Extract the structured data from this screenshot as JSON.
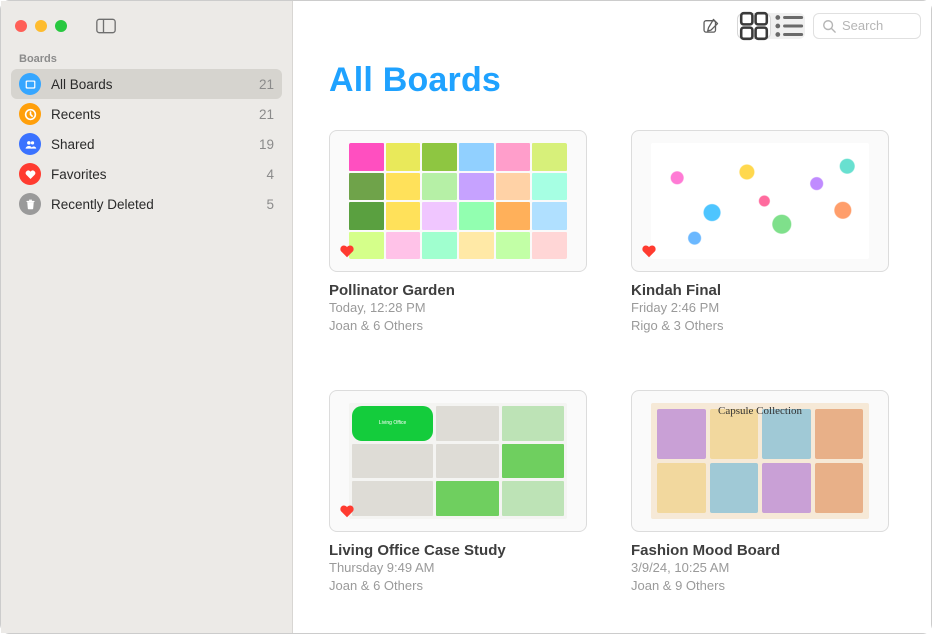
{
  "sidebar": {
    "header": "Boards",
    "items": [
      {
        "icon": "folder",
        "color": "ic-blue",
        "label": "All Boards",
        "count": 21,
        "selected": true
      },
      {
        "icon": "clock",
        "color": "ic-orange",
        "label": "Recents",
        "count": 21,
        "selected": false
      },
      {
        "icon": "people",
        "color": "ic-dblue",
        "label": "Shared",
        "count": 19,
        "selected": false
      },
      {
        "icon": "heart",
        "color": "ic-red",
        "label": "Favorites",
        "count": 4,
        "selected": false
      },
      {
        "icon": "trash",
        "color": "ic-gray",
        "label": "Recently Deleted",
        "count": 5,
        "selected": false
      }
    ]
  },
  "toolbar": {
    "compose_icon": "compose",
    "grid_icon": "grid",
    "list_icon": "list",
    "search_placeholder": "Search",
    "active_view": "grid"
  },
  "page": {
    "title": "All Boards"
  },
  "boards": [
    {
      "title": "Pollinator Garden",
      "time": "Today, 12:28 PM",
      "people": "Joan & 6 Others",
      "favorite": true,
      "art": "garden"
    },
    {
      "title": "Kindah Final",
      "time": "Friday 2:46 PM",
      "people": "Rigo & 3 Others",
      "favorite": true,
      "art": "doodle"
    },
    {
      "title": "Living Office Case Study",
      "time": "Thursday 9:49 AM",
      "people": "Joan & 6 Others",
      "favorite": true,
      "art": "office"
    },
    {
      "title": "Fashion Mood Board",
      "time": "3/9/24, 10:25 AM",
      "people": "Joan & 9 Others",
      "favorite": false,
      "art": "fashion"
    }
  ]
}
